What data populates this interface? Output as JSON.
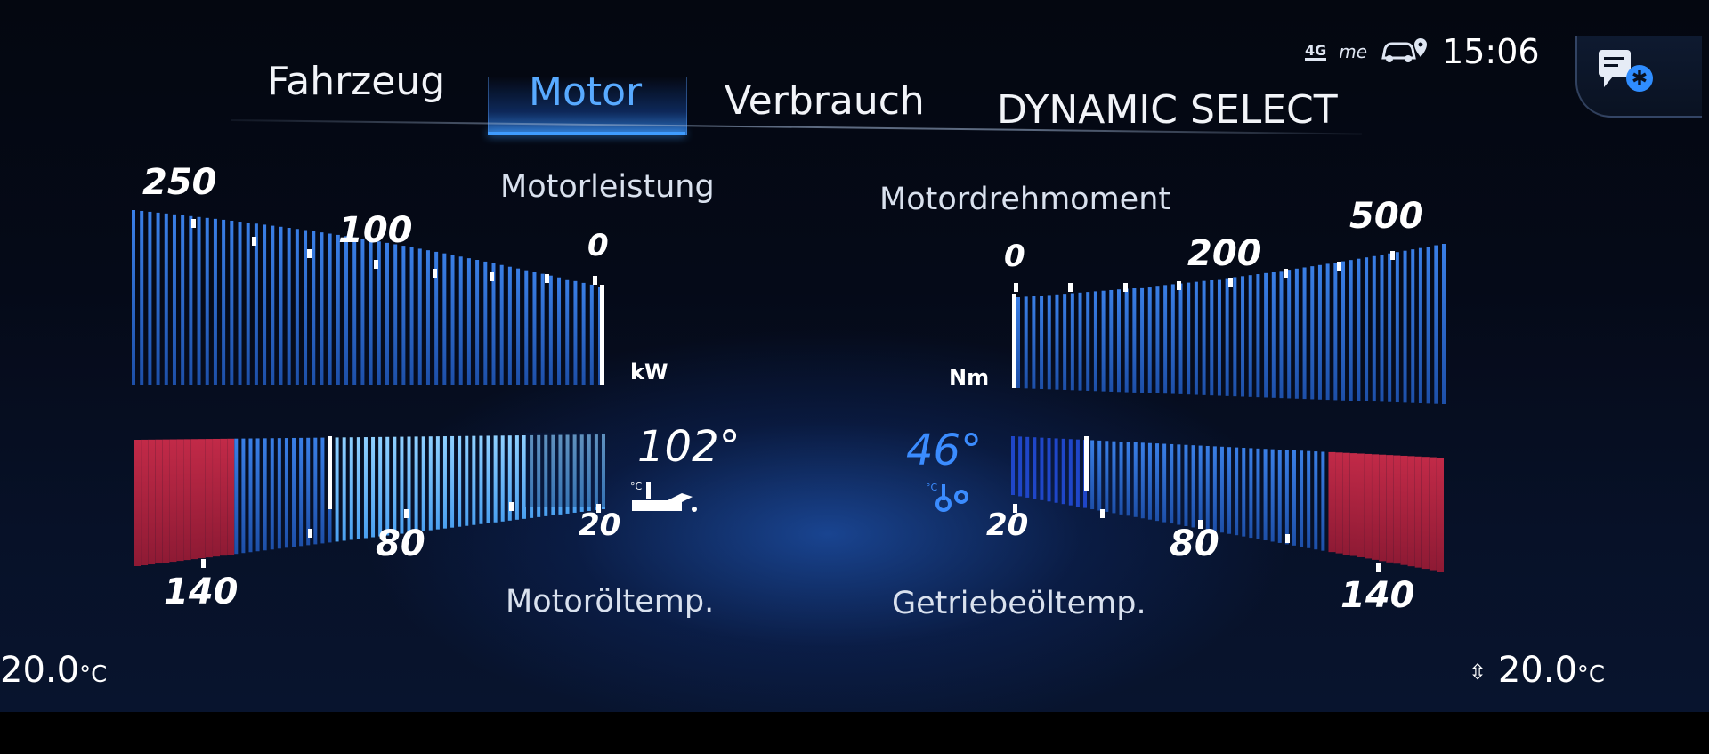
{
  "tabs": [
    {
      "label": "Fahrzeug",
      "active": false
    },
    {
      "label": "Motor",
      "active": true
    },
    {
      "label": "Verbrauch",
      "active": false
    },
    {
      "label": "DYNAMIC SELECT",
      "active": false
    }
  ],
  "status_bar": {
    "network": "4G",
    "me_icon": "mercedes-me-icon",
    "car_location_icon": "car-location-icon",
    "time": "15:06",
    "notification_icon": "notification-settings-icon"
  },
  "motorleistung": {
    "title": "Motorleistung",
    "unit": "kW",
    "scale_labels": [
      "250",
      "100",
      "0"
    ],
    "current_value": 0
  },
  "motordrehmoment": {
    "title": "Motordrehmoment",
    "unit": "Nm",
    "scale_labels": [
      "0",
      "200",
      "500"
    ],
    "current_value": 0
  },
  "motoroeltemp": {
    "title": "Motoröltemp.",
    "value": "102°",
    "value_numeric": 102,
    "scale_labels": [
      "140",
      "80",
      "20"
    ],
    "icon": "oil-temperature-icon"
  },
  "getriebeoeltemp": {
    "title": "Getriebeöltemp.",
    "value": "46°",
    "value_numeric": 46,
    "scale_labels": [
      "20",
      "80",
      "140"
    ],
    "icon": "transmission-temperature-icon"
  },
  "climate": {
    "left_temp": "20.0",
    "right_temp": "20.0",
    "unit": "°C"
  },
  "colors": {
    "accent": "#58aaff",
    "gauge_blue": "#2f6fd8",
    "gauge_bright": "#7cc4ff",
    "warning_red": "#b3263f"
  }
}
